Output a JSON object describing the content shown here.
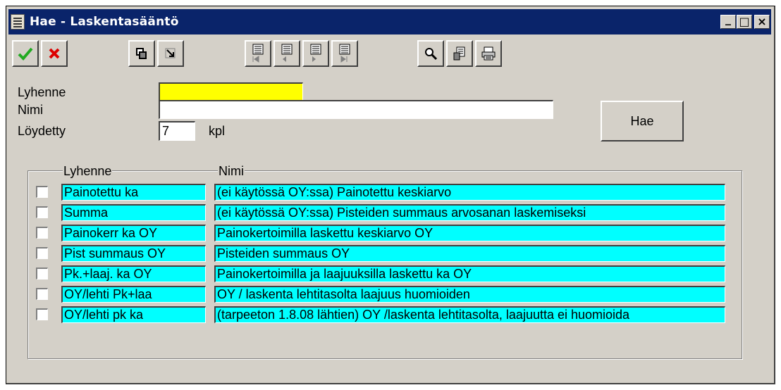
{
  "window": {
    "title": "Hae - Laskentasääntö",
    "controls": {
      "minimize": "_",
      "maximize": "□",
      "close": "×"
    }
  },
  "toolbar": {
    "buttons": [
      {
        "name": "accept-button",
        "icon": "checkmark-icon",
        "color": "#22aa22"
      },
      {
        "name": "cancel-button",
        "icon": "x-icon",
        "color": "#dd0000"
      },
      {
        "name": "restore-button",
        "icon": "window-restore-icon"
      },
      {
        "name": "goto-button",
        "icon": "arrow-icon"
      },
      {
        "name": "first-record-button",
        "icon": "first-record-icon"
      },
      {
        "name": "previous-record-button",
        "icon": "previous-record-icon"
      },
      {
        "name": "next-record-button",
        "icon": "next-record-icon"
      },
      {
        "name": "last-record-button",
        "icon": "last-record-icon"
      },
      {
        "name": "search-button",
        "icon": "magnifier-icon"
      },
      {
        "name": "document-button",
        "icon": "document-icon"
      },
      {
        "name": "print-button",
        "icon": "printer-icon"
      }
    ]
  },
  "form": {
    "lyhenne_label": "Lyhenne",
    "lyhenne_value": "",
    "nimi_label": "Nimi",
    "nimi_value": "",
    "loydetty_label": "Löydetty",
    "loydetty_value": "7",
    "loydetty_unit": "kpl",
    "search_button": "Hae"
  },
  "results": {
    "col_lyhenne": "Lyhenne",
    "col_nimi": "Nimi",
    "rows": [
      {
        "lyhenne": "Painotettu ka",
        "nimi": "(ei käytössä OY:ssa) Painotettu keskiarvo"
      },
      {
        "lyhenne": "Summa",
        "nimi": "(ei käytössä OY:ssa) Pisteiden summaus arvosanan laskemiseksi"
      },
      {
        "lyhenne": "Painokerr ka OY",
        "nimi": "Painokertoimilla laskettu keskiarvo OY"
      },
      {
        "lyhenne": "Pist summaus OY",
        "nimi": "Pisteiden summaus OY"
      },
      {
        "lyhenne": "Pk.+laaj. ka OY",
        "nimi": "Painokertoimilla ja laajuuksilla laskettu ka OY"
      },
      {
        "lyhenne": "OY/lehti Pk+laa",
        "nimi": "OY / laskenta lehtitasolta laajuus huomioiden"
      },
      {
        "lyhenne": "OY/lehti pk ka",
        "nimi": "(tarpeeton 1.8.08 lähtien) OY /laskenta lehtitasolta, laajuutta ei huomioida"
      }
    ]
  },
  "colors": {
    "titlebar": "#0a246a",
    "lyhenne_field": "#ffff00",
    "result_cell": "#00ffff",
    "window_bg": "#d4d0c8"
  }
}
